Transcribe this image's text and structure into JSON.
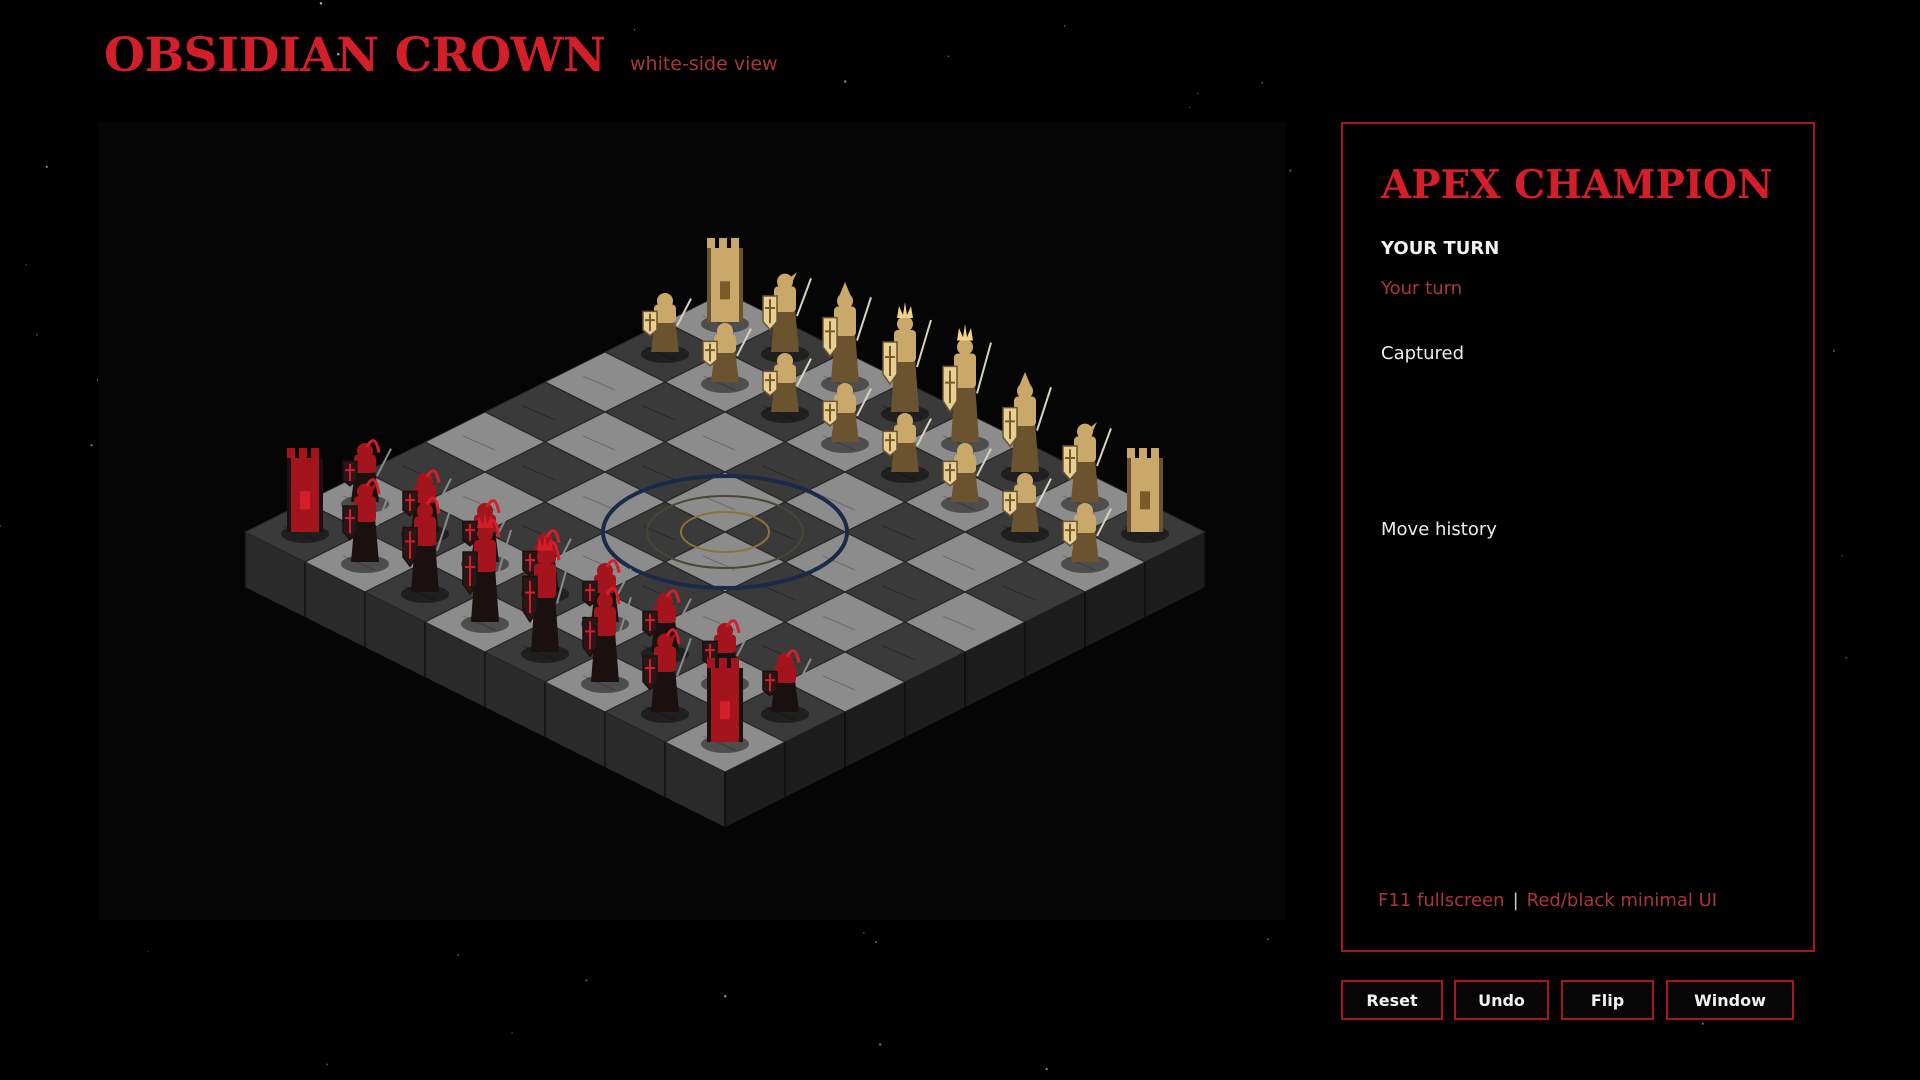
{
  "header": {
    "title": "OBSIDIAN CROWN",
    "view_label": "white-side view"
  },
  "panel": {
    "title": "APEX CHAMPION",
    "turn_header": "YOUR TURN",
    "turn_text": "Your turn",
    "captured_label": "Captured",
    "history_label": "Move history",
    "footer_left": "F11 fullscreen",
    "footer_sep": "|",
    "footer_right": "Red/black minimal UI"
  },
  "controls": {
    "reset": "Reset",
    "undo": "Undo",
    "flip": "Flip",
    "window": "Window"
  },
  "board": {
    "files": 8,
    "ranks": 8,
    "light_square": "#8c8c8c",
    "dark_square": "#3a3a3a",
    "gold_army": "#c9a86a",
    "red_army": "#a3141c",
    "back_rank": [
      "rook",
      "knight",
      "bishop",
      "queen",
      "king",
      "bishop",
      "knight",
      "rook"
    ]
  },
  "colors": {
    "accent": "#d41f2b",
    "muted_red": "#a8373d",
    "border": "#a8161f"
  }
}
